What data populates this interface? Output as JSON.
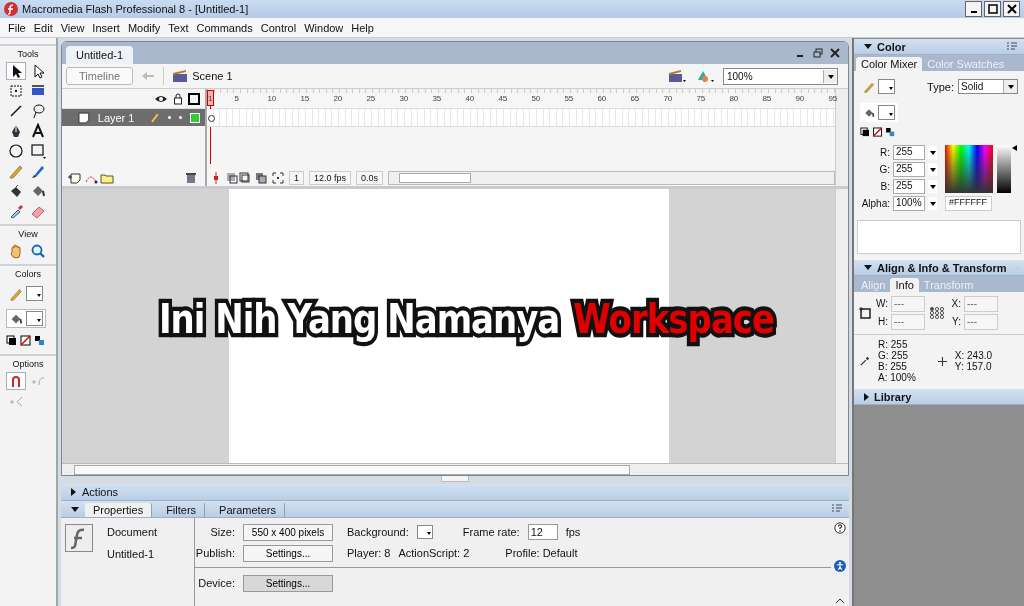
{
  "window": {
    "title": "Macromedia Flash Professional 8 - [Untitled-1]"
  },
  "menu": [
    "File",
    "Edit",
    "View",
    "Insert",
    "Modify",
    "Text",
    "Commands",
    "Control",
    "Window",
    "Help"
  ],
  "toolbox": [
    {
      "title": "Tools",
      "items": [
        {
          "kind": "arrow",
          "selected": true
        },
        {
          "kind": "subselect",
          "selected": false
        },
        {
          "kind": "transform",
          "selected": false
        },
        {
          "kind": "gradient",
          "selected": false
        },
        {
          "kind": "line",
          "selected": false
        },
        {
          "kind": "lasso",
          "selected": false
        },
        {
          "kind": "pen",
          "selected": false
        },
        {
          "kind": "text",
          "selected": false
        },
        {
          "kind": "oval",
          "selected": false
        },
        {
          "kind": "rect",
          "selected": false
        },
        {
          "kind": "pencil",
          "selected": false
        },
        {
          "kind": "brush",
          "selected": false
        },
        {
          "kind": "inkbottle",
          "selected": false
        },
        {
          "kind": "bucket",
          "selected": false
        },
        {
          "kind": "dropper",
          "selected": false
        },
        {
          "kind": "eraser",
          "selected": false
        }
      ]
    },
    {
      "title": "View",
      "items": [
        {
          "kind": "hand",
          "selected": false
        },
        {
          "kind": "zoom",
          "selected": false
        }
      ]
    },
    {
      "title": "Colors",
      "items": [
        {
          "kind": "stroke",
          "selected": false
        },
        {
          "kind": "fill",
          "selected": true
        },
        {
          "kind": "swapbar"
        }
      ]
    },
    {
      "title": "Options",
      "items": [
        {
          "kind": "magnet",
          "selected": true
        },
        {
          "kind": "smooth",
          "selected": false
        },
        {
          "kind": "straighten",
          "selected": false
        }
      ]
    }
  ],
  "document": {
    "tab": "Untitled-1",
    "timeline_button": "Timeline",
    "scene": "Scene 1",
    "zoom": "100%"
  },
  "timeline": {
    "layers": [
      {
        "name": "Layer 1",
        "selected": true
      }
    ],
    "ruler": [
      "1",
      "5",
      "10",
      "15",
      "20",
      "25",
      "30",
      "35",
      "40",
      "45",
      "50",
      "55",
      "60",
      "65",
      "70",
      "75",
      "80",
      "85",
      "90",
      "95"
    ],
    "current_frame": "1",
    "frame_rate": "12.0 fps",
    "elapsed": "0.0s"
  },
  "stage_text": [
    {
      "text": "Ini Nih Yang Namanya",
      "color": "#ffffff"
    },
    {
      "text": "Workspace",
      "color": "#e00000"
    }
  ],
  "actions": {
    "title": "Actions",
    "expanded": false
  },
  "properties": {
    "expanded": true,
    "tabs": [
      {
        "label": "Properties",
        "selected": true
      },
      {
        "label": "Filters",
        "selected": false
      },
      {
        "label": "Parameters",
        "selected": false
      }
    ],
    "document_label": "Document",
    "document_name": "Untitled-1",
    "size_label": "Size:",
    "size_value": "550 x 400 pixels",
    "background_label": "Background:",
    "frame_rate_label": "Frame rate:",
    "frame_rate": "12",
    "fps_unit": "fps",
    "publish_label": "Publish:",
    "publish_button": "Settings...",
    "player": "Player: 8",
    "actionscript": "ActionScript: 2",
    "profile": "Profile: Default",
    "device_label": "Device:",
    "device_button": "Settings..."
  },
  "color_panel": {
    "title": "Color",
    "expanded": true,
    "tabs": [
      {
        "label": "Color Mixer",
        "selected": true
      },
      {
        "label": "Color Swatches",
        "selected": false
      }
    ],
    "type_label": "Type:",
    "type_value": "Solid",
    "channels": [
      {
        "label": "R:",
        "value": "255"
      },
      {
        "label": "G:",
        "value": "255"
      },
      {
        "label": "B:",
        "value": "255"
      },
      {
        "label": "Alpha:",
        "value": "100%"
      }
    ],
    "hex": "#FFFFFF",
    "brightness": {
      "level": 1
    }
  },
  "info_panel": {
    "title": "Align & Info & Transform",
    "expanded": true,
    "tabs": [
      {
        "label": "Align",
        "selected": false
      },
      {
        "label": "Info",
        "selected": true
      },
      {
        "label": "Transform",
        "selected": false
      }
    ],
    "size_fields": [
      {
        "label": "W:",
        "value": "---"
      },
      {
        "label": "H:",
        "value": "---"
      }
    ],
    "pos_fields": [
      {
        "label": "X:",
        "value": "---"
      },
      {
        "label": "Y:",
        "value": "---"
      }
    ],
    "color_readout": [
      "R: 255",
      "G: 255",
      "B: 255",
      "A: 100%"
    ],
    "cursor_readout": [
      "X: 243.0",
      "Y: 157.0"
    ]
  },
  "library": {
    "title": "Library",
    "expanded": false
  }
}
